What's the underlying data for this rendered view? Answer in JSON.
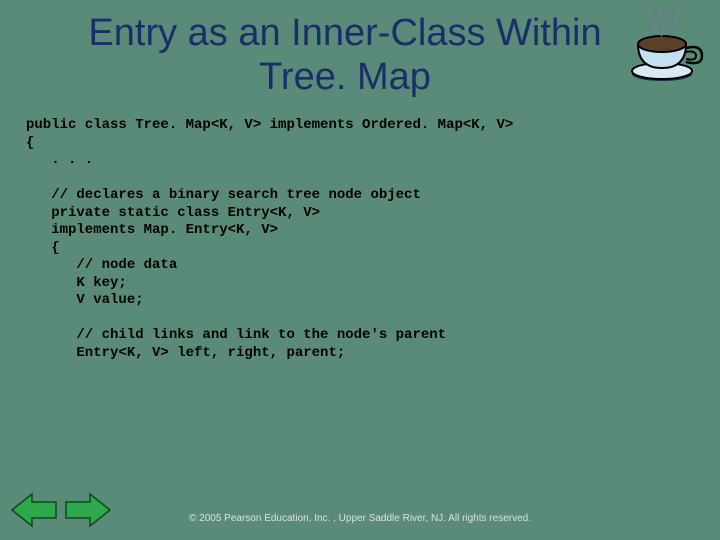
{
  "title": "Entry as an Inner-Class Within Tree. Map",
  "code": "public class Tree. Map<K, V> implements Ordered. Map<K, V>\n{\n   . . .\n\n   // declares a binary search tree node object\n   private static class Entry<K, V>\n   implements Map. Entry<K, V>\n   {\n      // node data\n      K key;\n      V value;\n\n      // child links and link to the node's parent\n      Entry<K, V> left, right, parent;",
  "footer": "© 2005 Pearson Education, Inc. , Upper Saddle River, NJ.  All rights reserved.",
  "icons": {
    "teacup": "teacup-icon",
    "prev": "previous-arrow",
    "next": "next-arrow"
  }
}
